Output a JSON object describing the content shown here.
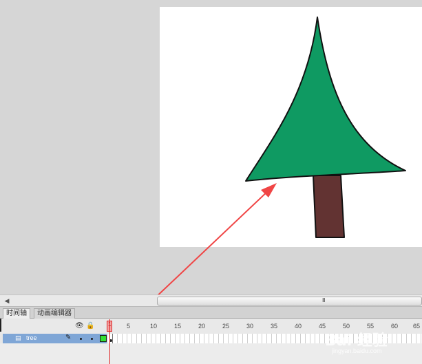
{
  "window": {
    "colors": {
      "workspace": "#d6d6d6",
      "stage": "#ffffff",
      "tree_foliage": "#0f9a62",
      "tree_trunk": "#623332",
      "arrow": "#f04545",
      "layer_highlight": "#7fa6d6",
      "layer_color_box": "#33e033",
      "playhead": "#dd2222"
    }
  },
  "scrollbar": {
    "left_arrow": "◀",
    "grip": "III"
  },
  "timeline": {
    "tabs": [
      {
        "label": "时间轴"
      },
      {
        "label": "动画编辑器"
      }
    ],
    "header_icons": {
      "eye": "eye-icon",
      "lock": "lock-icon",
      "outline": "outline-icon"
    },
    "playhead_frame": "1",
    "frame_numbers": [
      "5",
      "10",
      "15",
      "20",
      "25",
      "30",
      "35",
      "40",
      "45",
      "50",
      "55",
      "60",
      "65"
    ],
    "layers": [
      {
        "name": "tree",
        "icon": "layer-icon",
        "edit_icon": "pencil-icon",
        "color": "#33e033"
      }
    ]
  },
  "watermark": {
    "logo": "Bai 经验",
    "url": "jingyan.baidu.com"
  }
}
